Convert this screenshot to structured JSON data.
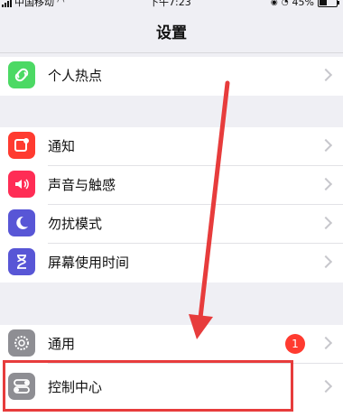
{
  "status": {
    "carrier": "中国移动",
    "time": "下午7:23",
    "battery": "45%"
  },
  "nav": {
    "title": "设置"
  },
  "group1": {
    "items": [
      {
        "label": "个人热点",
        "icon": "hotspot-icon",
        "color": "#4cd964"
      }
    ]
  },
  "group2": {
    "items": [
      {
        "label": "通知",
        "icon": "notifications-icon",
        "color": "#ff3b30"
      },
      {
        "label": "声音与触感",
        "icon": "sound-icon",
        "color": "#ff2d55"
      },
      {
        "label": "勿扰模式",
        "icon": "do-not-disturb-icon",
        "color": "#5856d6"
      },
      {
        "label": "屏幕使用时间",
        "icon": "screen-time-icon",
        "color": "#5856d6"
      }
    ]
  },
  "group3": {
    "items": [
      {
        "label": "通用",
        "icon": "gear-icon",
        "color": "#8e8e93",
        "badge": "1"
      },
      {
        "label": "控制中心",
        "icon": "control-center-icon",
        "color": "#8e8e93"
      }
    ]
  },
  "colors": {
    "highlight": "#e73c3c",
    "background": "#efeff4"
  }
}
